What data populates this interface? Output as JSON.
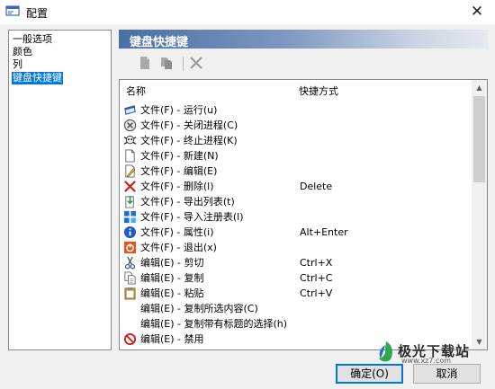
{
  "window": {
    "title": "配置",
    "close": "✕"
  },
  "nav": {
    "items": [
      "一般选项",
      "颜色",
      "列",
      "键盘快捷键"
    ]
  },
  "section": {
    "title": "键盘快捷键"
  },
  "columns": {
    "name": "名称",
    "shortcut": "快捷方式"
  },
  "shortcuts": [
    {
      "icon": "window-icon",
      "command": "文件(F) - 运行(u)",
      "key": ""
    },
    {
      "icon": "terminate-icon",
      "command": "文件(F) - 关闭进程(C)",
      "key": ""
    },
    {
      "icon": "skull-icon",
      "command": "文件(F) - 终止进程(K)",
      "key": ""
    },
    {
      "icon": "new-file-icon",
      "command": "文件(F) - 新建(N)",
      "key": ""
    },
    {
      "icon": "edit-file-icon",
      "command": "文件(F) - 编辑(E)",
      "key": ""
    },
    {
      "icon": "delete-x-icon",
      "command": "文件(F) - 删除(l)",
      "key": "Delete"
    },
    {
      "icon": "export-icon",
      "command": "文件(F) - 导出列表(t)",
      "key": ""
    },
    {
      "icon": "registry-icon",
      "command": "文件(F) - 导入注册表(l)",
      "key": ""
    },
    {
      "icon": "info-icon",
      "command": "文件(F) - 属性(i)",
      "key": "Alt+Enter"
    },
    {
      "icon": "exit-icon",
      "command": "文件(F) - 退出(x)",
      "key": ""
    },
    {
      "icon": "scissors-icon",
      "command": "编辑(E) - 剪切",
      "key": "Ctrl+X"
    },
    {
      "icon": "copy-icon",
      "command": "编辑(E) - 复制",
      "key": "Ctrl+C"
    },
    {
      "icon": "paste-icon",
      "command": "编辑(E) - 粘贴",
      "key": "Ctrl+V"
    },
    {
      "icon": "",
      "command": "编辑(E) - 复制所选内容(C)",
      "key": ""
    },
    {
      "icon": "",
      "command": "编辑(E) - 复制带有标题的选择(h)",
      "key": ""
    },
    {
      "icon": "disable-icon",
      "command": "编辑(E) - 禁用",
      "key": ""
    }
  ],
  "buttons": {
    "ok": "确定(O)",
    "cancel": "取消"
  },
  "watermark": {
    "text": "极光下载站",
    "url": "www.xz7.com"
  },
  "colors": {
    "accent": "#0078d7",
    "header_start": "#4a6fa5"
  }
}
